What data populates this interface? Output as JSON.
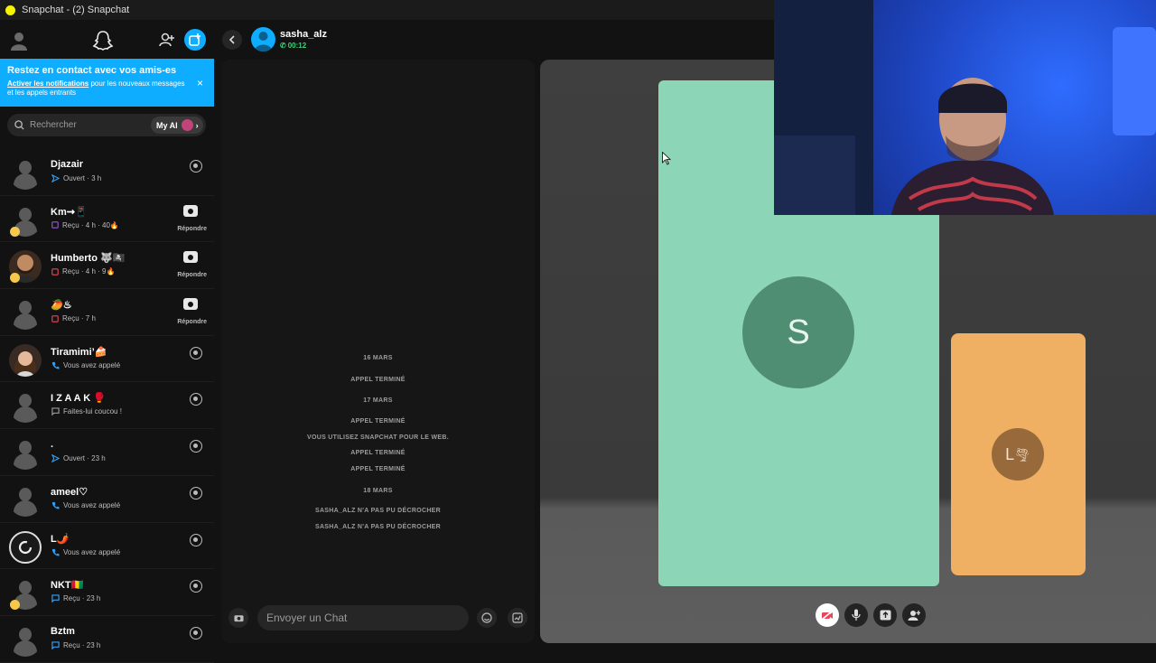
{
  "window": {
    "title": "Snapchat - (2) Snapchat"
  },
  "sidebar": {
    "banner": {
      "title": "Restez en contact avec vos amis-es",
      "link": "Activer les notifications",
      "text": " pour les nouveaux messages et les appels entrants",
      "close": "×"
    },
    "search": {
      "placeholder": "Rechercher",
      "my_ai": "My AI"
    },
    "conversations": [
      {
        "name": "Djazair",
        "status": "Ouvert · 3 h",
        "status_icon": "sent-arrow-icon",
        "status_color": "#2ea3ff",
        "action": "camera"
      },
      {
        "name": "Km⇝📱",
        "status": "Reçu · 4 h · 40🔥",
        "status_icon": "received-square-icon",
        "status_color": "#9b59d0",
        "action": "reply",
        "reply_label": "Répondre",
        "badge": true
      },
      {
        "name": "Humberto 🐺🏴‍☠️",
        "status": "Reçu · 4 h · 9🔥",
        "status_icon": "received-square-icon",
        "status_color": "#e8475a",
        "action": "reply",
        "reply_label": "Répondre",
        "badge": true,
        "bitmoji": "beard"
      },
      {
        "name": "🥭♨",
        "status": "Reçu · 7 h",
        "status_icon": "received-square-icon",
        "status_color": "#e8475a",
        "action": "reply",
        "reply_label": "Répondre"
      },
      {
        "name": "Tiramimi’🍰",
        "status": "Vous avez appelé",
        "status_icon": "call-icon",
        "status_color": "#2ea3ff",
        "action": "camera",
        "bitmoji": "girl"
      },
      {
        "name": "I Z A A K 🥊",
        "status": "Faites-lui coucou !",
        "status_icon": "chat-square-icon",
        "status_color": "#9a9a9a",
        "action": "camera"
      },
      {
        "name": ".",
        "status": "Ouvert · 23 h",
        "status_icon": "sent-arrow-icon",
        "status_color": "#2ea3ff",
        "action": "camera"
      },
      {
        "name": "ameel♡",
        "status": "Vous avez appelé",
        "status_icon": "call-icon",
        "status_color": "#2ea3ff",
        "action": "camera"
      },
      {
        "name": "L🌶️",
        "status": "Vous avez appelé",
        "status_icon": "call-icon",
        "status_color": "#2ea3ff",
        "action": "camera",
        "bitmoji": "ring"
      },
      {
        "name": "NKT🇬🇳",
        "status": "Reçu · 23 h",
        "status_icon": "chat-square-icon",
        "status_color": "#2ea3ff",
        "action": "camera",
        "badge": true
      },
      {
        "name": "Bztm",
        "status": "Reçu · 23 h",
        "status_icon": "chat-square-icon",
        "status_color": "#2ea3ff",
        "action": "camera"
      }
    ]
  },
  "chat": {
    "contact": {
      "name": "sasha_alz",
      "call_time": "00:12"
    },
    "messages": [
      "16 MARS",
      "APPEL TERMINÉ",
      "17 MARS",
      "APPEL TERMINÉ",
      "VOUS UTILISEZ SNAPCHAT POUR LE WEB.",
      "APPEL TERMINÉ",
      "APPEL TERMINÉ",
      "18 MARS",
      "SASHA_ALZ N'A PAS PU DÉCROCHER",
      "SASHA_ALZ N'A PAS PU DÉCROCHER"
    ],
    "input_placeholder": "Envoyer un Chat"
  },
  "call": {
    "main_participant_initial": "S",
    "main_color": "#8dd5b7",
    "side_participant_initial": "L",
    "side_color": "#efb064"
  }
}
